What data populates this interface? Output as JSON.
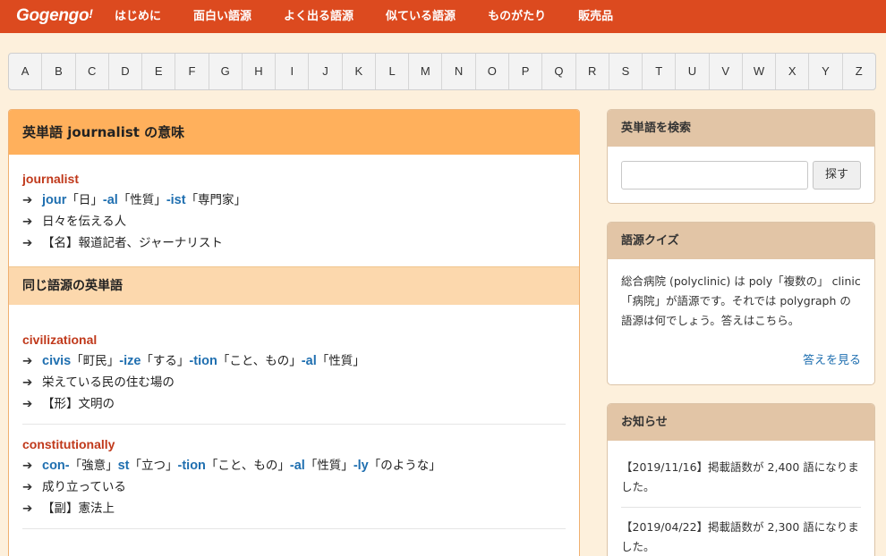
{
  "nav": {
    "logo": "Gogengo",
    "logo_mark": "!",
    "links": [
      "はじめに",
      "面白い語源",
      "よく出る語源",
      "似ている語源",
      "ものがたり",
      "販売品"
    ]
  },
  "alphabet": [
    "A",
    "B",
    "C",
    "D",
    "E",
    "F",
    "G",
    "H",
    "I",
    "J",
    "K",
    "L",
    "M",
    "N",
    "O",
    "P",
    "Q",
    "R",
    "S",
    "T",
    "U",
    "V",
    "W",
    "X",
    "Y",
    "Z"
  ],
  "main": {
    "title": "英単語 journalist の意味",
    "entry": {
      "word": "journalist",
      "parts": [
        {
          "part": "jour",
          "gloss": "「日」"
        },
        {
          "part": "-al",
          "gloss": "「性質」"
        },
        {
          "part": "-ist",
          "gloss": "「専門家」"
        }
      ],
      "meaning": "日々を伝える人",
      "definition": "【名】報道記者、ジャーナリスト"
    },
    "related_title": "同じ語源の英単語",
    "related": [
      {
        "word": "civilizational",
        "parts": [
          {
            "part": "civis",
            "gloss": "「町民」"
          },
          {
            "part": "-ize",
            "gloss": "「する」"
          },
          {
            "part": "-tion",
            "gloss": "「こと、もの」"
          },
          {
            "part": "-al",
            "gloss": "「性質」"
          }
        ],
        "meaning": "栄えている民の住む場の",
        "definition": "【形】文明の"
      },
      {
        "word": "constitutionally",
        "parts": [
          {
            "part": "con-",
            "gloss": "「強意」"
          },
          {
            "part": "st",
            "gloss": "「立つ」"
          },
          {
            "part": "-tion",
            "gloss": "「こと、もの」"
          },
          {
            "part": "-al",
            "gloss": "「性質」"
          },
          {
            "part": "-ly",
            "gloss": "「のような」"
          }
        ],
        "meaning": "成り立っている",
        "definition": "【副】憲法上"
      }
    ]
  },
  "search": {
    "title": "英単語を検索",
    "placeholder": "",
    "button": "探す"
  },
  "quiz": {
    "title": "語源クイズ",
    "text": "総合病院 (polyclinic) は poly「複数の」 clinic「病院」が語源です。それでは polygraph の語源は何でしょう。答えはこちら。",
    "link": "答えを見る"
  },
  "news": {
    "title": "お知らせ",
    "items": [
      "【2019/11/16】掲載語数が 2,400 語になりました。",
      "【2019/04/22】掲載語数が 2,300 語になりました。"
    ]
  },
  "icons": {
    "arrow": "arrow-right-icon"
  },
  "colors": {
    "nav": "#dc4a1f",
    "main_header": "#ffb05c",
    "sub_header": "#fcd8ad",
    "side_header": "#e2c5a6",
    "word": "#c0391b",
    "part": "#1f6fb0",
    "background": "#fdf0dc"
  }
}
